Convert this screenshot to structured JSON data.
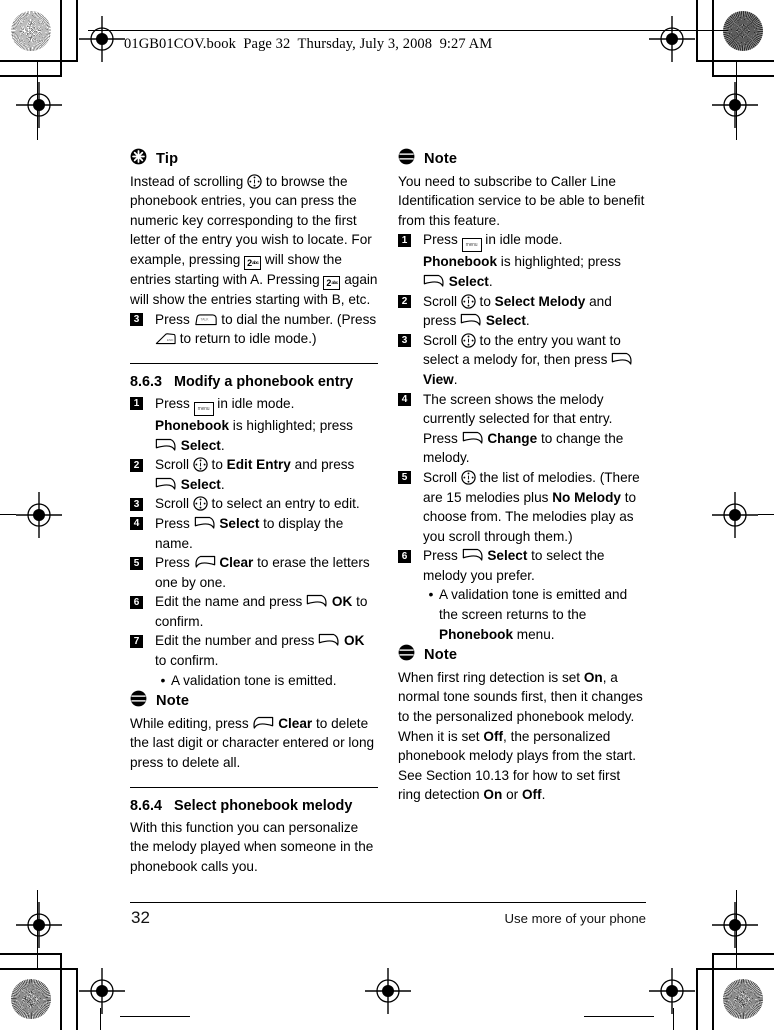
{
  "page": {
    "file_header": "01GB01COV.book  Page 32  Thursday, July 3, 2008  9:27 AM",
    "footer_page_number": "32",
    "footer_running_title": "Use more of your phone"
  },
  "left_column": {
    "tip": {
      "icon": "tip-asterisk-icon",
      "label": "Tip",
      "para_1": "Instead of scrolling ",
      "para_2": " to browse the phonebook entries, you can press the numeric key corresponding to the first letter of the entry you wish to locate. For example, pressing ",
      "para_3": " will show the entries starting with A. Pressing ",
      "para_4": " again will show the entries starting with B, etc.",
      "key_2_label": "2",
      "key_2_sub": "abc"
    },
    "tip_step": {
      "num": "3",
      "text_1": "Press ",
      "text_2": " to dial the number. (Press ",
      "text_3": " to return to idle mode.)"
    },
    "section_863": {
      "number": "8.6.3",
      "title": "Modify a phonebook entry",
      "steps": [
        {
          "num": "1",
          "t1": "Press ",
          "t2": " in idle mode.",
          "t3": "Phonebook",
          "t4": " is highlighted; press ",
          "t5": "Select",
          "t6": "."
        },
        {
          "num": "2",
          "t1": "Scroll ",
          "t2": " to ",
          "t3": "Edit Entry",
          "t4": " and press ",
          "t5": "Select",
          "t6": "."
        },
        {
          "num": "3",
          "t1": "Scroll ",
          "t2": " to select an entry to edit."
        },
        {
          "num": "4",
          "t1": "Press ",
          "t2": "Select",
          "t3": " to display the name."
        },
        {
          "num": "5",
          "t1": "Press ",
          "t2": "Clear",
          "t3": " to erase the letters one by one."
        },
        {
          "num": "6",
          "t1": "Edit the name and press ",
          "t2": "OK",
          "t3": " to confirm."
        },
        {
          "num": "7",
          "t1": "Edit the number and press ",
          "t2": "OK",
          "t3": " to confirm."
        }
      ],
      "bullet": "A validation tone is emitted."
    },
    "note_1": {
      "icon": "note-lines-icon",
      "label": "Note",
      "t1": "While editing, press ",
      "t2": "Clear",
      "t3": " to delete the last digit or character entered or long press to delete all."
    },
    "section_864": {
      "number": "8.6.4",
      "title": "Select phonebook melody",
      "body": "With this function you can personalize the melody played when someone in the phonebook calls you."
    }
  },
  "right_column": {
    "note_caller_line": {
      "icon": "note-lines-icon",
      "label": "Note",
      "body": "You need to subscribe to Caller Line Identification service to be able to benefit from this feature."
    },
    "steps": [
      {
        "num": "1",
        "t1": "Press ",
        "t2": " in idle mode.",
        "t3": "Phonebook",
        "t4": " is highlighted; press ",
        "t5": "Select",
        "t6": "."
      },
      {
        "num": "2",
        "t1": "Scroll ",
        "t2": " to ",
        "t3": "Select Melody",
        "t4": " and press ",
        "t5": "Select",
        "t6": "."
      },
      {
        "num": "3",
        "t1": "Scroll ",
        "t2": " to the entry you want to select a melody for, then press ",
        "t3": "View",
        "t4": "."
      },
      {
        "num": "4",
        "t1": "The screen shows the melody currently selected for that entry. Press ",
        "t2": "Change",
        "t3": " to change the melody."
      },
      {
        "num": "5",
        "t1": "Scroll ",
        "t2": " the list of melodies. (There are 15 melodies plus ",
        "t3": "No Melody",
        "t4": " to choose from. The melodies play as you scroll through them.)"
      },
      {
        "num": "6",
        "t1": "Press ",
        "t2": "Select",
        "t3": " to select the melody you prefer."
      }
    ],
    "bullet": {
      "t1": "A validation tone is emitted and the screen returns to the ",
      "t2": "Phonebook",
      "t3": " menu."
    },
    "note_ring": {
      "icon": "note-lines-icon",
      "label": "Note",
      "t1": "When first ring detection is set ",
      "t2": "On",
      "t3": ", a normal tone sounds first, then it changes to the personalized phonebook melody. When it is set ",
      "t4": "Off",
      "t5": ", the personalized phonebook melody plays from the start. See Section 10.13 for how to set first ring detection ",
      "t6": "On",
      "t7": " or ",
      "t8": "Off",
      "t9": "."
    }
  },
  "print_marks": {
    "registration_icon": "registration-crosshair-icon",
    "rosette_icon": "color-rosette-icon"
  }
}
